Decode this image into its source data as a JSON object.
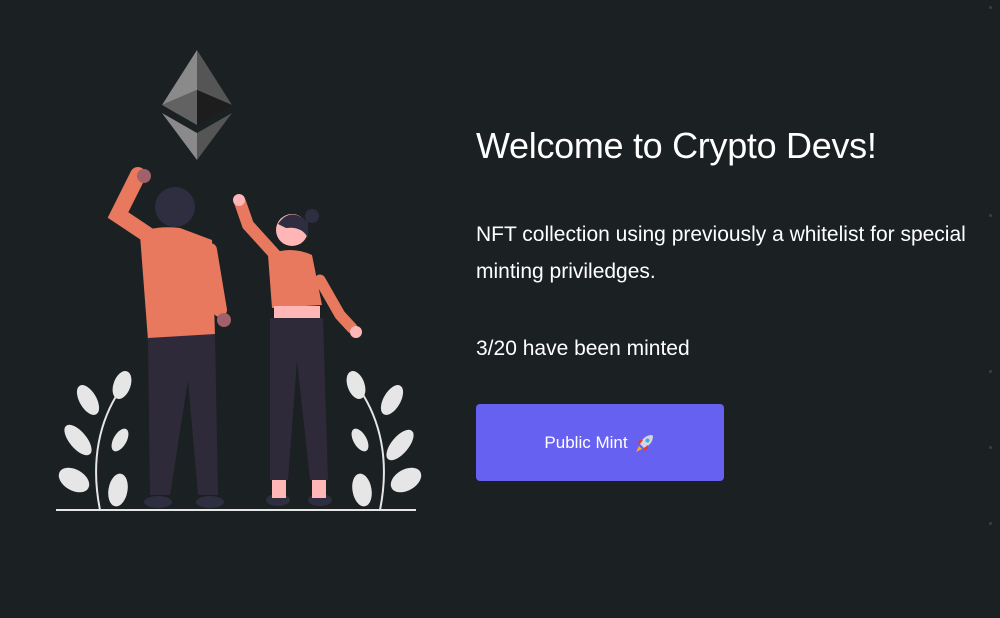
{
  "hero": {
    "title": "Welcome to Crypto Devs!",
    "description": "NFT collection using previously a whitelist for special minting priviledges.",
    "mint_count": "3/20 have been minted"
  },
  "mint_button": {
    "label": "Public Mint",
    "icon": "rocket-icon"
  },
  "colors": {
    "background": "#1b2022",
    "accent": "#6761f2",
    "figure_top": "#e8795e",
    "figure_pants": "#2f2a3a"
  }
}
